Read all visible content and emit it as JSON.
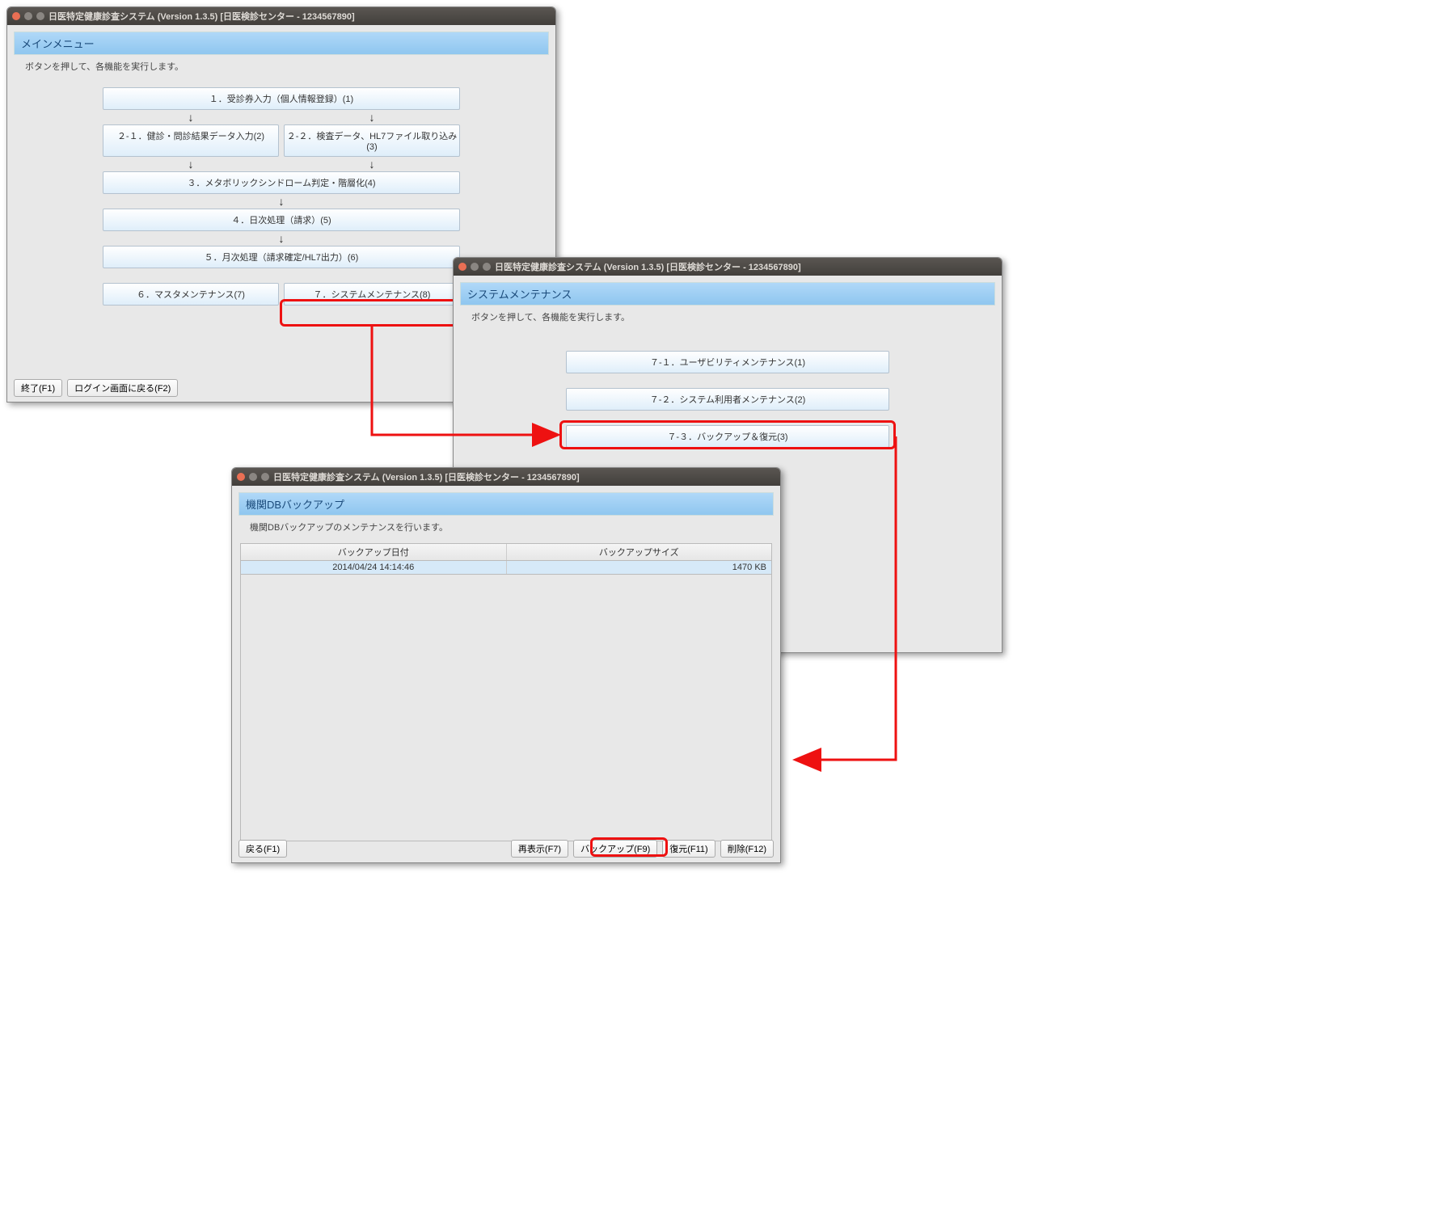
{
  "window_title": "日医特定健康診査システム (Version 1.3.5) [日医検診センター - 1234567890]",
  "win1": {
    "header": "メインメニュー",
    "instruction": "ボタンを押して、各機能を実行します。",
    "btn1": "１．受診券入力（個人情報登録）(1)",
    "btn2_1": "２-１．健診・問診結果データ入力(2)",
    "btn2_2": "２-２．検査データ、HL7ファイル取り込み(3)",
    "btn3": "３．メタボリックシンドローム判定・階層化(4)",
    "btn4": "４．日次処理（請求）(5)",
    "btn5": "５．月次処理（請求確定/HL7出力）(6)",
    "btn6": "６．マスタメンテナンス(7)",
    "btn7": "７．システムメンテナンス(8)",
    "exit": "終了(F1)",
    "back_login": "ログイン画面に戻る(F2)"
  },
  "win2": {
    "header": "システムメンテナンス",
    "instruction": "ボタンを押して、各機能を実行します。",
    "btn71": "７-１．ユーザビリティメンテナンス(1)",
    "btn72": "７-２．システム利用者メンテナンス(2)",
    "btn73": "７-３．バックアップ＆復元(3)"
  },
  "win3": {
    "header": "機関DBバックアップ",
    "instruction": "機関DBバックアップのメンテナンスを行います。",
    "col_date": "バックアップ日付",
    "col_size": "バックアップサイズ",
    "row_date": "2014/04/24 14:14:46",
    "row_size": "1470 KB",
    "back": "戻る(F1)",
    "refresh": "再表示(F7)",
    "backup": "バックアップ(F9)",
    "restore": "復元(F11)",
    "delete": "削除(F12)"
  },
  "arrow": "↓"
}
